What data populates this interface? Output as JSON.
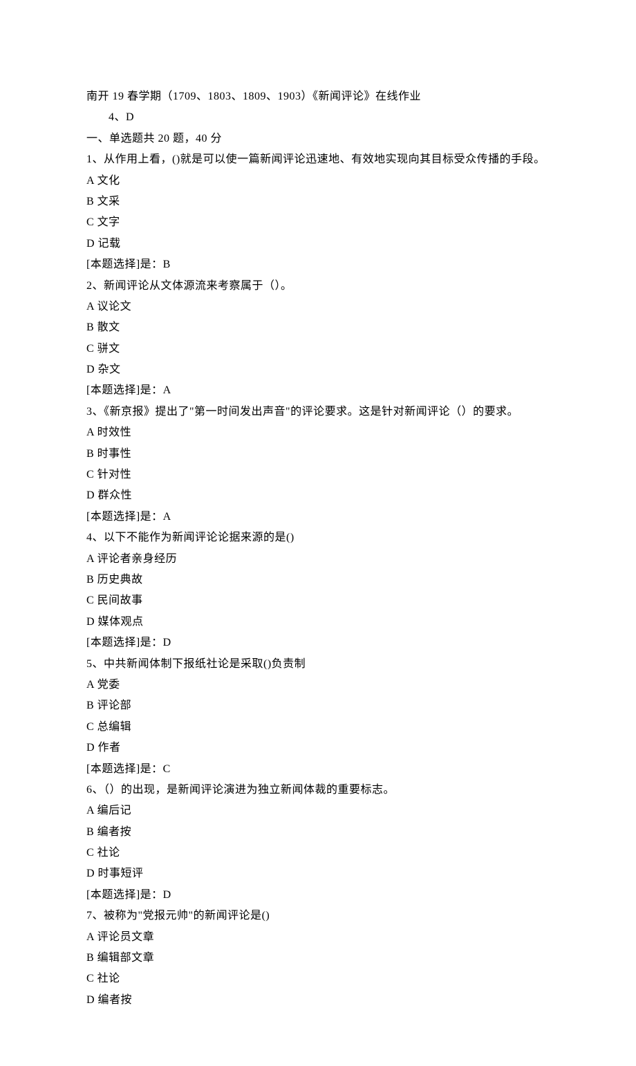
{
  "header": {
    "title": "南开 19 春学期（1709、1803、1809、1903）《新闻评论》在线作业",
    "sub": "4、D"
  },
  "section1": {
    "heading": "一、单选题共 20 题，40 分"
  },
  "q1": {
    "stem": "1、从作用上看，()就是可以使一篇新闻评论迅速地、有效地实现向其目标受众传播的手段。",
    "a": "A 文化",
    "b": "B 文采",
    "c": "C 文字",
    "d": "D 记载",
    "ans": "[本题选择]是：B"
  },
  "q2": {
    "stem": "2、新闻评论从文体源流来考察属于（）。",
    "a": "A 议论文",
    "b": "B 散文",
    "c": "C 骈文",
    "d": "D 杂文",
    "ans": "[本题选择]是：A"
  },
  "q3": {
    "stem": "3、《新京报》提出了\"第一时间发出声音\"的评论要求。这是针对新闻评论（）的要求。",
    "a": "A 时效性",
    "b": "B 时事性",
    "c": "C 针对性",
    "d": "D 群众性",
    "ans": "[本题选择]是：A"
  },
  "q4": {
    "stem": "4、以下不能作为新闻评论论据来源的是()",
    "a": "A 评论者亲身经历",
    "b": "B 历史典故",
    "c": "C 民间故事",
    "d": "D 媒体观点",
    "ans": "[本题选择]是：D"
  },
  "q5": {
    "stem": "5、中共新闻体制下报纸社论是采取()负责制",
    "a": "A 党委",
    "b": "B 评论部",
    "c": "C 总编辑",
    "d": "D 作者",
    "ans": "[本题选择]是：C"
  },
  "q6": {
    "stem": "6、（）的出现，是新闻评论演进为独立新闻体裁的重要标志。",
    "a": "A 编后记",
    "b": "B 编者按",
    "c": "C 社论",
    "d": "D 时事短评",
    "ans": "[本题选择]是：D"
  },
  "q7": {
    "stem": "7、被称为\"党报元帅\"的新闻评论是()",
    "a": "A 评论员文章",
    "b": "B 编辑部文章",
    "c": "C 社论",
    "d": "D 编者按"
  }
}
